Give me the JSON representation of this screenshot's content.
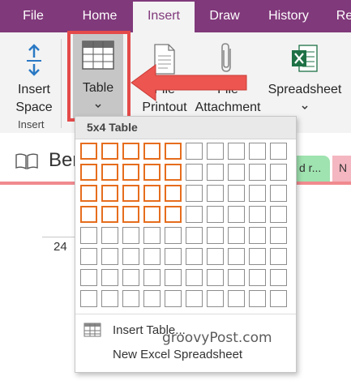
{
  "tabs": [
    "File",
    "Home",
    "Insert",
    "Draw",
    "History",
    "Re"
  ],
  "ribbon": {
    "insert_space_line1": "Insert",
    "insert_space_line2": "Space",
    "table": "Table",
    "file_printout_line1": "File",
    "file_printout_line2": "Printout",
    "file_attachment_line1": "File",
    "file_attachment_line2": "Attachment",
    "spreadsheet": "Spreadsheet",
    "group_insert": "Insert"
  },
  "notebook": {
    "section_title": "Ber",
    "page_tab_1": "d r...",
    "page_tab_2": "N",
    "date_fragment": "24"
  },
  "dropdown": {
    "title": "5x4 Table",
    "selected_columns": 5,
    "selected_rows": 4,
    "grid_columns": 10,
    "grid_rows": 8,
    "insert_table": "Insert Table...",
    "new_excel": "New Excel Spreadsheet"
  },
  "watermark": "groovyPost.com",
  "colors": {
    "tabbar": "#80397b",
    "highlight": "#e44a4a",
    "selection": "#e66d1d"
  }
}
